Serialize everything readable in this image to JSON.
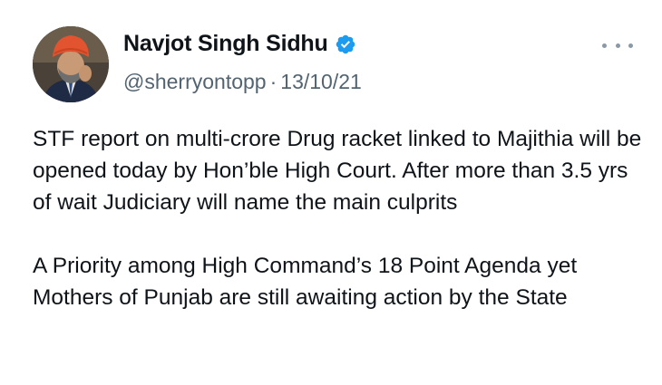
{
  "tweet": {
    "author": {
      "display_name": "Navjot Singh Sidhu",
      "handle": "@sherryontopp",
      "verified": true,
      "avatar_icon": "profile-photo",
      "verified_icon": "verified-badge-icon",
      "verified_color": "#1d9bf0"
    },
    "separator": "·",
    "date": "13/10/21",
    "more_icon": "more-options-icon",
    "paragraphs": [
      "STF report on multi-crore Drug racket linked to Majithia will be opened today by Hon’ble High Court. After more than 3.5 yrs of wait Judiciary will name the main culprits",
      "A Priority among High Command’s 18 Point Agenda yet Mothers of Punjab are still awaiting action by the State"
    ]
  }
}
